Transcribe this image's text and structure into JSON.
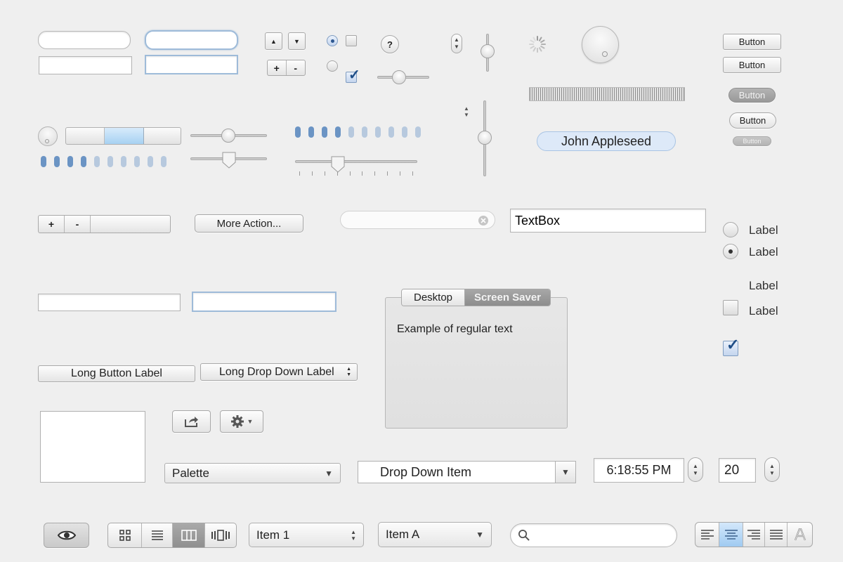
{
  "buttons": {
    "button1": "Button",
    "button2": "Button",
    "button3": "Button",
    "button4": "Button",
    "button5": "Button",
    "more_action": "More Action...",
    "long_button": "Long Button Label",
    "long_dropdown": "Long Drop Down Label",
    "plus": "+",
    "minus": "-",
    "help": "?"
  },
  "token": {
    "name": "John Appleseed"
  },
  "textbox": {
    "value": "TextBox"
  },
  "radios": [
    {
      "label": "Label",
      "checked": false
    },
    {
      "label": "Label",
      "checked": true
    }
  ],
  "checkboxes": [
    {
      "label": "Label",
      "checked": false
    },
    {
      "label": "Label",
      "checked": true
    }
  ],
  "tabs": {
    "items": [
      "Desktop",
      "Screen Saver"
    ],
    "selected": "Screen Saver",
    "body_text": "Example of regular text"
  },
  "palette": {
    "value": "Palette"
  },
  "dropdown_item": {
    "value": "Drop Down Item"
  },
  "time": {
    "value": "6:18:55 PM"
  },
  "number": {
    "value": "20"
  },
  "toolbar": {
    "item_popup": "Item 1",
    "item_pulldown": "Item A"
  },
  "sliders": {
    "horizontal_small": 0.45,
    "discrete_ticks_count": 10,
    "discrete_value": 0.3,
    "vertical_small": 0.45,
    "vertical_tall": 0.5
  },
  "level_dots": {
    "top": {
      "total": 10,
      "filled": 4
    },
    "left": {
      "total": 10,
      "filled": 4
    }
  },
  "colors": {
    "accent_blue": "#6b94c4",
    "focus_ring": "#9ebbd9",
    "background": "#efefef"
  },
  "icons": [
    "search-icon",
    "eye-icon",
    "share-icon",
    "gear-icon",
    "grid-view-icon",
    "list-view-icon",
    "column-view-icon",
    "coverflow-view-icon",
    "align-left-icon",
    "align-center-icon",
    "align-right-icon",
    "align-justify-icon",
    "text-style-icon",
    "clear-icon",
    "spinner-icon"
  ]
}
